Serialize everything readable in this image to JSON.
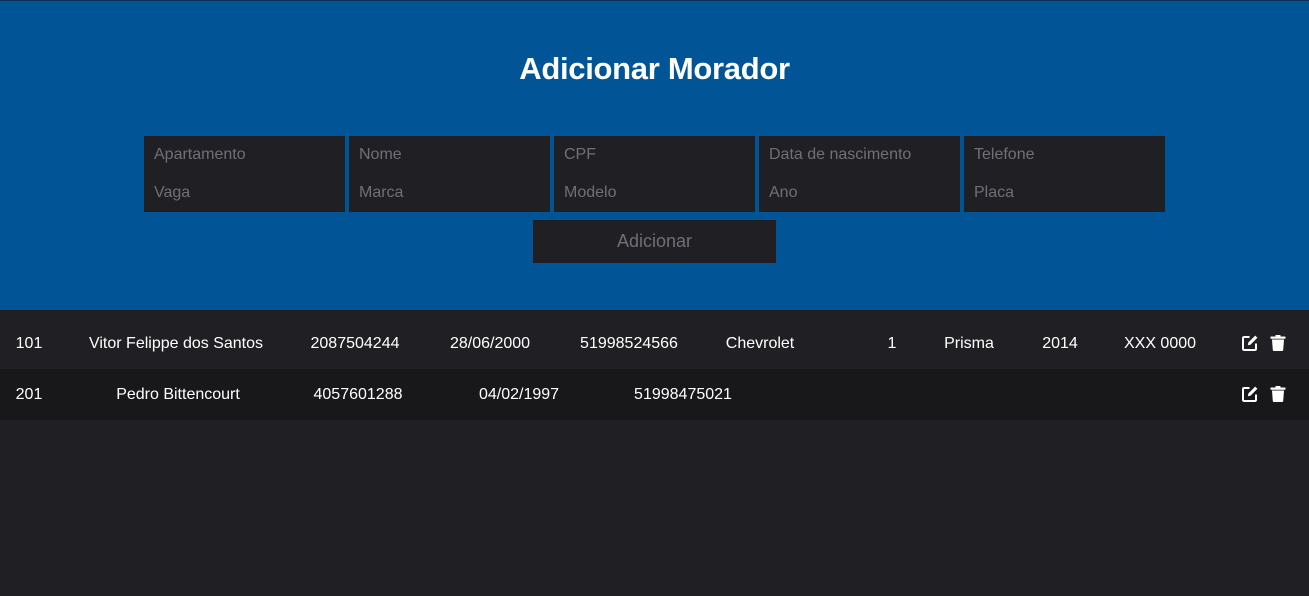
{
  "form": {
    "title": "Adicionar Morador",
    "placeholders": {
      "apartamento": "Apartamento",
      "vaga": "Vaga",
      "nome": "Nome",
      "marca": "Marca",
      "cpf": "CPF",
      "modelo": "Modelo",
      "nascimento": "Data de nascimento",
      "ano": "Ano",
      "telefone": "Telefone",
      "placa": "Placa"
    },
    "submit_label": "Adicionar"
  },
  "rows": [
    {
      "apartamento": "101",
      "nome": "Vitor Felippe dos Santos",
      "cpf": "2087504244",
      "nascimento": "28/06/2000",
      "telefone": "51998524566",
      "marca": "Chevrolet",
      "vaga": "1",
      "modelo": "Prisma",
      "ano": "2014",
      "placa": "XXX 0000",
      "edit_icon": "edit-icon",
      "delete_icon": "trash-icon"
    },
    {
      "apartamento": "201",
      "nome": "Pedro Bittencourt",
      "cpf": "4057601288",
      "nascimento": "04/02/1997",
      "telefone": "51998475021",
      "edit_icon": "edit-icon",
      "delete_icon": "trash-icon"
    }
  ],
  "colors": {
    "header_bg": "#015496",
    "page_bg": "#202024",
    "alt_row_bg": "#18181b",
    "input_bg": "#202024",
    "placeholder": "#6f6f76"
  }
}
